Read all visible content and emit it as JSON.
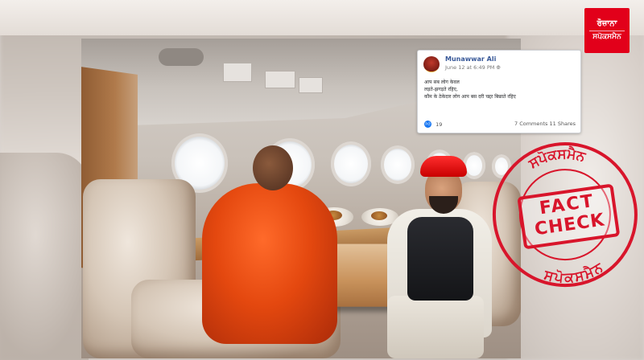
{
  "post": {
    "author": "Munawwar Ali",
    "timestamp": "June 12 at 6:49 PM",
    "privacy_icon": "globe-icon",
    "lines": [
      "आप सब लोग केवल",
      "लड़ते-झगड़ते रहिए,",
      "कौम के ठेकेदार लोग आप बस दरी चद्दर बिछाते रहिए"
    ],
    "likes": "19",
    "comments": "7 Comments",
    "shares": "11 Shares"
  },
  "logo": {
    "line1": "ਰੋਜ਼ਾਨਾ",
    "line2": "ਸਪੋਕਸਮੈਨ",
    "color": "#e2001a"
  },
  "stamp": {
    "line1": "FACT",
    "line2": "CHECK",
    "ring_top": "ਸਪੋਕਸਮੈਨ",
    "ring_bottom": "ਸਪੋਕਸਮੈਨ",
    "color": "#d8152b"
  }
}
